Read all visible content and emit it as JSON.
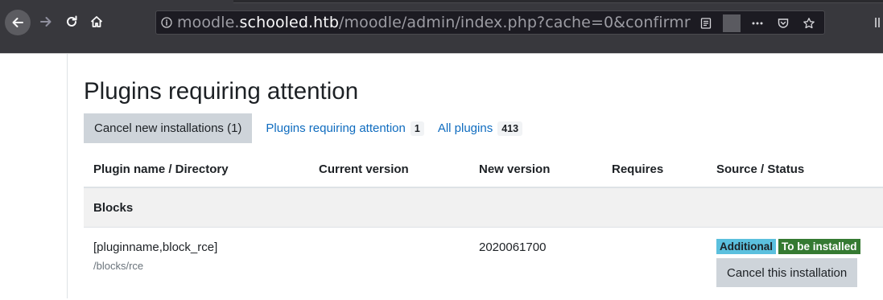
{
  "browser": {
    "url_scheme_host_prefix": "moodle.",
    "url_host": "schooled.htb",
    "url_path": "/moodle/admin/index.php?cache=0&confirmr"
  },
  "page": {
    "title": "Plugins requiring attention",
    "tabs": {
      "cancel_label": "Cancel new installations (1)",
      "attention_label": "Plugins requiring attention",
      "attention_count": "1",
      "all_label": "All plugins",
      "all_count": "413"
    },
    "table": {
      "headers": [
        "Plugin name / Directory",
        "Current version",
        "New version",
        "Requires",
        "Source / Status"
      ],
      "group": "Blocks",
      "row": {
        "name": "[pluginname,block_rce]",
        "directory": "/blocks/rce",
        "current_version": "",
        "new_version": "2020061700",
        "requires": "",
        "source_badge": "Additional",
        "status_badge": "To be installed",
        "action_label": "Cancel this installation"
      }
    }
  },
  "colors": {
    "link": "#0f6cbf",
    "additional_badge": "#5bc0de",
    "to_be_installed_badge": "#357a32",
    "button_gray": "#ced4da"
  }
}
